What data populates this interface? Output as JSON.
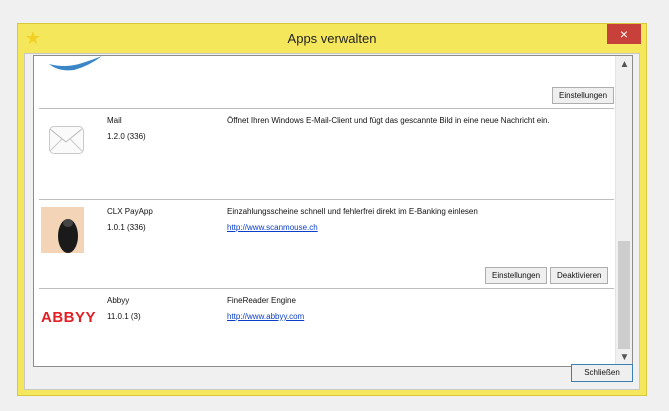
{
  "window": {
    "title": "Apps verwalten",
    "close_label": "×",
    "app_icon": "star-icon"
  },
  "apps": [
    {
      "name": "",
      "version": "",
      "description": "",
      "link": "",
      "buttons": [
        "Einstellungen"
      ]
    },
    {
      "name": "Mail",
      "version": "1.2.0 (336)",
      "description": "Öffnet Ihren Windows E-Mail-Client und fügt das gescannte Bild in eine neue Nachricht ein.",
      "link": "",
      "buttons": []
    },
    {
      "name": "CLX PayApp",
      "version": "1.0.1 (336)",
      "description": "Einzahlungsscheine schnell und fehlerfrei direkt im E-Banking einlesen",
      "link": "http://www.scanmouse.ch",
      "buttons": [
        "Einstellungen",
        "Deaktivieren"
      ]
    },
    {
      "name": "Abbyy",
      "version": "11.0.1 (3)",
      "description": "FineReader Engine",
      "link": "http://www.abbyy.com",
      "logo_text": "ABBYY",
      "buttons": []
    }
  ],
  "footer": {
    "close_button": "Schließen"
  },
  "colors": {
    "title_bar": "#f5e75b",
    "close_button": "#c7403a",
    "link": "#0b3ec9",
    "abbyy_red": "#e31e24"
  }
}
